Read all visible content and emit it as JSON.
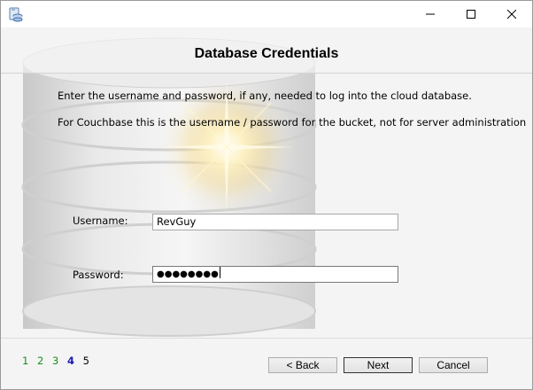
{
  "titlebar": {
    "icon": "app-database-icon",
    "minimize_icon": "minimize-icon",
    "maximize_icon": "maximize-icon",
    "close_icon": "close-icon"
  },
  "header": {
    "title": "Database Credentials"
  },
  "description": {
    "line1": "Enter the username and password, if any, needed to log into the cloud database.",
    "line2": "For Couchbase this is the username / password for the bucket, not for server administration"
  },
  "form": {
    "username_label": "Username:",
    "username_value": "RevGuy",
    "password_label": "Password:",
    "password_value": "●●●●●●●●"
  },
  "steps": [
    {
      "label": "1",
      "state": "done"
    },
    {
      "label": "2",
      "state": "done"
    },
    {
      "label": "3",
      "state": "done"
    },
    {
      "label": "4",
      "state": "current"
    },
    {
      "label": "5",
      "state": "upcoming"
    }
  ],
  "buttons": {
    "back": "< Back",
    "next": "Next",
    "cancel": "Cancel"
  },
  "colors": {
    "step_done": "#1a8f1a",
    "step_current": "#1a1ab0"
  }
}
